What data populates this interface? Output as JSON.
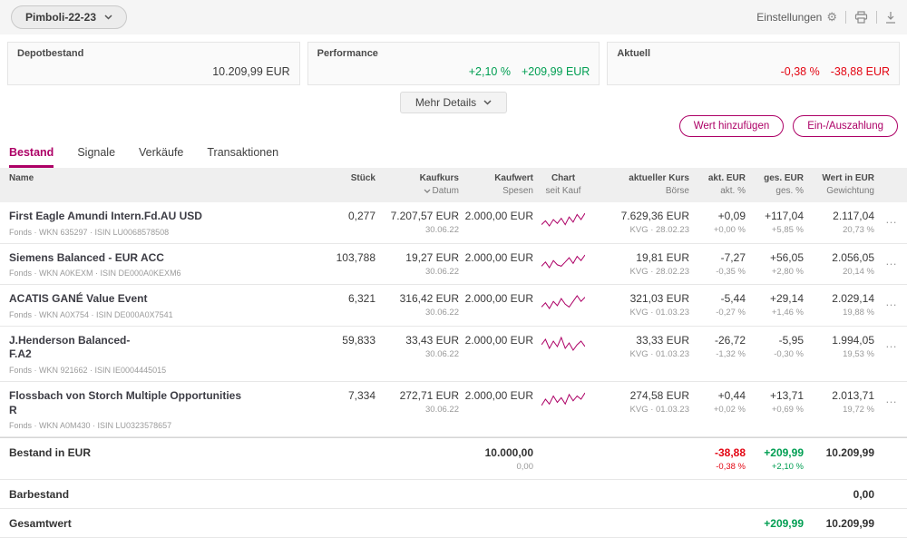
{
  "colors": {
    "accent": "#ad0066",
    "green": "#009e52",
    "red": "#e30613"
  },
  "topbar": {
    "depot": "Pimboli-22-23",
    "settings": "Einstellungen"
  },
  "icons": {
    "settings": "gear",
    "print": "printer",
    "download": "download",
    "sort": "chevron-down",
    "row_menu": "ellipsis"
  },
  "cards": {
    "depot": {
      "label": "Depotbestand",
      "value": "10.209,99 EUR"
    },
    "performance": {
      "label": "Performance",
      "pct": "+2,10 %",
      "value": "+209,99 EUR"
    },
    "aktuell": {
      "label": "Aktuell",
      "pct": "-0,38 %",
      "value": "-38,88 EUR"
    }
  },
  "more_details": "Mehr Details",
  "buttons": {
    "add": "Wert hinzufügen",
    "payment": "Ein-/Auszahlung"
  },
  "tabs": [
    {
      "label": "Bestand",
      "active": true
    },
    {
      "label": "Signale",
      "active": false
    },
    {
      "label": "Verkäufe",
      "active": false
    },
    {
      "label": "Transaktionen",
      "active": false
    }
  ],
  "table": {
    "headers": {
      "name": "Name",
      "stueck": "Stück",
      "kaufkurs": "Kaufkurs",
      "kaufkurs2": "Datum",
      "kaufwert": "Kaufwert",
      "kaufwert2": "Spesen",
      "chart": "Chart",
      "chart2": "seit Kauf",
      "kurs": "aktueller Kurs",
      "kurs2": "Börse",
      "akt": "akt. EUR",
      "akt2": "akt. %",
      "ges": "ges. EUR",
      "ges2": "ges. %",
      "wert": "Wert in EUR",
      "wert2": "Gewichtung"
    },
    "rows": [
      {
        "name": "First Eagle Amundi Intern.Fd.AU USD",
        "name2": "",
        "sub": "Fonds · WKN 635297 · ISIN LU0068578508",
        "stueck": "0,277",
        "kaufkurs": "7.207,57 EUR",
        "datum": "30.06.22",
        "kaufwert": "2.000,00 EUR",
        "kurs": "7.629,36 EUR",
        "kurs_sub": "KVG · 28.02.23",
        "akt_eur": "+0,09",
        "akt_pct": "+0,00 %",
        "ges_eur": "+117,04",
        "ges_pct": "+5,85 %",
        "wert": "2.117,04",
        "gewicht": "20,73 %",
        "spark": [
          4,
          7,
          3,
          8,
          5,
          9,
          4,
          10,
          6,
          12,
          8,
          13
        ]
      },
      {
        "name": "Siemens Balanced - EUR ACC",
        "name2": "",
        "sub": "Fonds · WKN A0KEXM · ISIN DE000A0KEXM6",
        "stueck": "103,788",
        "kaufkurs": "19,27 EUR",
        "datum": "30.06.22",
        "kaufwert": "2.000,00 EUR",
        "kurs": "19,81 EUR",
        "kurs_sub": "KVG · 28.02.23",
        "akt_eur": "-7,27",
        "akt_pct": "-0,35 %",
        "ges_eur": "+56,05",
        "ges_pct": "+2,80 %",
        "wert": "2.056,05",
        "gewicht": "20,14 %",
        "spark": [
          6,
          9,
          5,
          10,
          7,
          6,
          9,
          12,
          8,
          13,
          10,
          14
        ]
      },
      {
        "name": "ACATIS GANÉ Value Event",
        "name2": "",
        "sub": "Fonds · WKN A0X754 · ISIN DE000A0X7541",
        "stueck": "6,321",
        "kaufkurs": "316,42 EUR",
        "datum": "30.06.22",
        "kaufwert": "2.000,00 EUR",
        "kurs": "321,03 EUR",
        "kurs_sub": "KVG · 01.03.23",
        "akt_eur": "-5,44",
        "akt_pct": "-0,27 %",
        "ges_eur": "+29,14",
        "ges_pct": "+1,46 %",
        "wert": "2.029,14",
        "gewicht": "19,88 %",
        "spark": [
          5,
          8,
          4,
          9,
          6,
          11,
          7,
          5,
          9,
          13,
          9,
          12
        ]
      },
      {
        "name": "J.Henderson Balanced-",
        "name2": "F.A2",
        "sub": "Fonds · WKN 921662 · ISIN IE0004445015",
        "stueck": "59,833",
        "kaufkurs": "33,43 EUR",
        "datum": "30.06.22",
        "kaufwert": "2.000,00 EUR",
        "kurs": "33,33 EUR",
        "kurs_sub": "KVG · 01.03.23",
        "akt_eur": "-26,72",
        "akt_pct": "-1,32 %",
        "ges_eur": "-5,95",
        "ges_pct": "-0,30 %",
        "wert": "1.994,05",
        "gewicht": "19,53 %",
        "spark": [
          8,
          11,
          6,
          10,
          7,
          12,
          6,
          9,
          5,
          8,
          10,
          7
        ]
      },
      {
        "name": "Flossbach von Storch Multiple Opportunities",
        "name2": "R",
        "sub": "Fonds · WKN A0M430 · ISIN LU0323578657",
        "stueck": "7,334",
        "kaufkurs": "272,71 EUR",
        "datum": "30.06.22",
        "kaufwert": "2.000,00 EUR",
        "kurs": "274,58 EUR",
        "kurs_sub": "KVG · 01.03.23",
        "akt_eur": "+0,44",
        "akt_pct": "+0,02 %",
        "ges_eur": "+13,71",
        "ges_pct": "+0,69 %",
        "wert": "2.013,71",
        "gewicht": "19,72 %",
        "spark": [
          5,
          9,
          6,
          11,
          7,
          10,
          6,
          12,
          8,
          11,
          9,
          13
        ]
      }
    ]
  },
  "totals": {
    "bestand": {
      "label": "Bestand in EUR",
      "kaufwert": "10.000,00",
      "spesen": "0,00",
      "akt": "-38,88",
      "akt_pct": "-0,38 %",
      "ges": "+209,99",
      "ges_pct": "+2,10 %",
      "wert": "10.209,99"
    },
    "barbestand": {
      "label": "Barbestand",
      "wert": "0,00"
    },
    "gesamt": {
      "label": "Gesamtwert",
      "ges": "+209,99",
      "wert": "10.209,99"
    }
  }
}
